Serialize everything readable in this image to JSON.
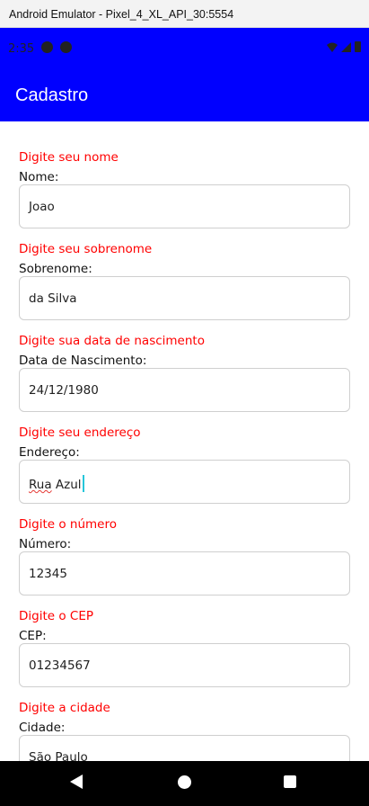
{
  "window": {
    "title": "Android Emulator - Pixel_4_XL_API_30:5554"
  },
  "status_bar": {
    "time": "2:35"
  },
  "app_bar": {
    "title": "Cadastro",
    "color": "#0000ff"
  },
  "form": {
    "fields": [
      {
        "hint": "Digite seu nome",
        "label": "Nome:",
        "value": "Joao"
      },
      {
        "hint": "Digite seu sobrenome",
        "label": "Sobrenome:",
        "value": "da Silva"
      },
      {
        "hint": "Digite sua data de nascimento",
        "label": "Data de Nascimento:",
        "value": "24/12/1980"
      },
      {
        "hint": "Digite seu endereço",
        "label": "Endereço:",
        "value_part1": "Rua",
        "value_part2": " Azul"
      },
      {
        "hint": "Digite o número",
        "label": "Número:",
        "value": "12345"
      },
      {
        "hint": "Digite o CEP",
        "label": "CEP:",
        "value": "01234567"
      },
      {
        "hint": "Digite a cidade",
        "label": "Cidade:",
        "value": "São Paulo"
      }
    ]
  },
  "colors": {
    "hint": "#ff0000",
    "caret": "#26c6da"
  },
  "nav_bar": {
    "icons": [
      "back-icon",
      "home-icon",
      "recents-icon"
    ]
  }
}
